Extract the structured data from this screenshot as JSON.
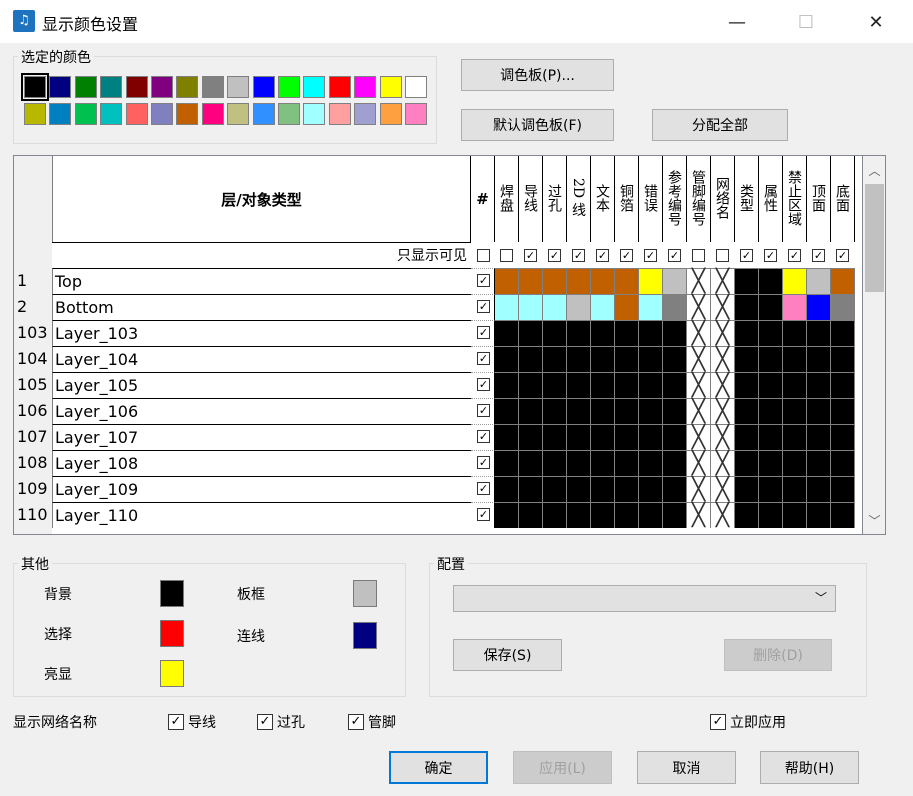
{
  "window": {
    "title": "显示颜色设置",
    "minimize": "—",
    "maximize": "☐",
    "close": "✕",
    "icon": "music-note-icon"
  },
  "palette_group": {
    "title": "选定的颜色",
    "row1": [
      "#000000",
      "#000080",
      "#008000",
      "#008080",
      "#800000",
      "#800080",
      "#808000",
      "#808080",
      "#c0c0c0",
      "#0000ff",
      "#00ff00",
      "#00ffff",
      "#ff0000",
      "#ff00ff",
      "#ffff00",
      "#ffffff"
    ],
    "row2": [
      "#b8b800",
      "#0080c0",
      "#00c050",
      "#00c0c0",
      "#ff6060",
      "#8080c0",
      "#c06000",
      "#ff0080",
      "#c0c080",
      "#3090ff",
      "#80c080",
      "#a0ffff",
      "#ffa0a0",
      "#a0a0d0",
      "#ffa040",
      "#ff80c0"
    ]
  },
  "buttons": {
    "palette": "调色板(P)...",
    "default_palette": "默认调色板(F)",
    "assign_all": "分配全部",
    "ok": "确定",
    "apply": "应用(L)",
    "cancel": "取消",
    "help": "帮助(H)",
    "save": "保存(S)",
    "delete": "删除(D)"
  },
  "grid": {
    "header_title": "层/对象类型",
    "hash": "#",
    "columns": [
      "焊盘",
      "导线",
      "过孔",
      "2D 线",
      "文本",
      "铜箔",
      "错误",
      "参考编号",
      "管脚编号",
      "网络名",
      "类型",
      "属性",
      "禁止区域",
      "顶面",
      "底面"
    ],
    "visible_only_label": "只显示可见",
    "visible_row_checks": [
      false,
      true,
      true,
      true,
      true,
      true,
      true,
      true,
      false,
      false,
      true,
      true,
      true,
      true,
      true
    ],
    "rows": [
      {
        "num": "1",
        "name": "Top",
        "checked": true,
        "colors": [
          "#c06000",
          "#c06000",
          "#c06000",
          "#c06000",
          "#c06000",
          "#c06000",
          "#ffff00",
          "#c0c0c0",
          "X",
          "X",
          "#000000",
          "#000000",
          "#ffff00",
          "#c0c0c0",
          "#c06000"
        ]
      },
      {
        "num": "2",
        "name": "Bottom",
        "checked": true,
        "colors": [
          "#a0ffff",
          "#a0ffff",
          "#a0ffff",
          "#c0c0c0",
          "#a0ffff",
          "#c06000",
          "#a0ffff",
          "#808080",
          "X",
          "X",
          "#000000",
          "#000000",
          "#ff80c0",
          "#0000ff",
          "#808080"
        ]
      },
      {
        "num": "103",
        "name": "Layer_103",
        "checked": true,
        "colors": [
          "#000000",
          "#000000",
          "#000000",
          "#000000",
          "#000000",
          "#000000",
          "#000000",
          "#000000",
          "X",
          "X",
          "#000000",
          "#000000",
          "#000000",
          "#000000",
          "#000000"
        ]
      },
      {
        "num": "104",
        "name": "Layer_104",
        "checked": true,
        "colors": [
          "#000000",
          "#000000",
          "#000000",
          "#000000",
          "#000000",
          "#000000",
          "#000000",
          "#000000",
          "X",
          "X",
          "#000000",
          "#000000",
          "#000000",
          "#000000",
          "#000000"
        ]
      },
      {
        "num": "105",
        "name": "Layer_105",
        "checked": true,
        "colors": [
          "#000000",
          "#000000",
          "#000000",
          "#000000",
          "#000000",
          "#000000",
          "#000000",
          "#000000",
          "X",
          "X",
          "#000000",
          "#000000",
          "#000000",
          "#000000",
          "#000000"
        ]
      },
      {
        "num": "106",
        "name": "Layer_106",
        "checked": true,
        "colors": [
          "#000000",
          "#000000",
          "#000000",
          "#000000",
          "#000000",
          "#000000",
          "#000000",
          "#000000",
          "X",
          "X",
          "#000000",
          "#000000",
          "#000000",
          "#000000",
          "#000000"
        ]
      },
      {
        "num": "107",
        "name": "Layer_107",
        "checked": true,
        "colors": [
          "#000000",
          "#000000",
          "#000000",
          "#000000",
          "#000000",
          "#000000",
          "#000000",
          "#000000",
          "X",
          "X",
          "#000000",
          "#000000",
          "#000000",
          "#000000",
          "#000000"
        ]
      },
      {
        "num": "108",
        "name": "Layer_108",
        "checked": true,
        "colors": [
          "#000000",
          "#000000",
          "#000000",
          "#000000",
          "#000000",
          "#000000",
          "#000000",
          "#000000",
          "X",
          "X",
          "#000000",
          "#000000",
          "#000000",
          "#000000",
          "#000000"
        ]
      },
      {
        "num": "109",
        "name": "Layer_109",
        "checked": true,
        "colors": [
          "#000000",
          "#000000",
          "#000000",
          "#000000",
          "#000000",
          "#000000",
          "#000000",
          "#000000",
          "X",
          "X",
          "#000000",
          "#000000",
          "#000000",
          "#000000",
          "#000000"
        ]
      },
      {
        "num": "110",
        "name": "Layer_110",
        "checked": true,
        "colors": [
          "#000000",
          "#000000",
          "#000000",
          "#000000",
          "#000000",
          "#000000",
          "#000000",
          "#000000",
          "X",
          "X",
          "#000000",
          "#000000",
          "#000000",
          "#000000",
          "#000000"
        ]
      }
    ]
  },
  "other": {
    "title": "其他",
    "background": {
      "label": "背景",
      "color": "#000000"
    },
    "board_frame": {
      "label": "板框",
      "color": "#c0c0c0"
    },
    "selection": {
      "label": "选择",
      "color": "#ff0000"
    },
    "connection": {
      "label": "连线",
      "color": "#000080"
    },
    "highlight": {
      "label": "亮显",
      "color": "#ffff00"
    }
  },
  "config": {
    "title": "配置",
    "select_value": ""
  },
  "net_names": {
    "label": "显示网络名称",
    "traces": {
      "label": "导线",
      "checked": true
    },
    "vias": {
      "label": "过孔",
      "checked": true
    },
    "pins": {
      "label": "管脚",
      "checked": true
    }
  },
  "apply_immediately": {
    "label": "立即应用",
    "checked": true
  }
}
